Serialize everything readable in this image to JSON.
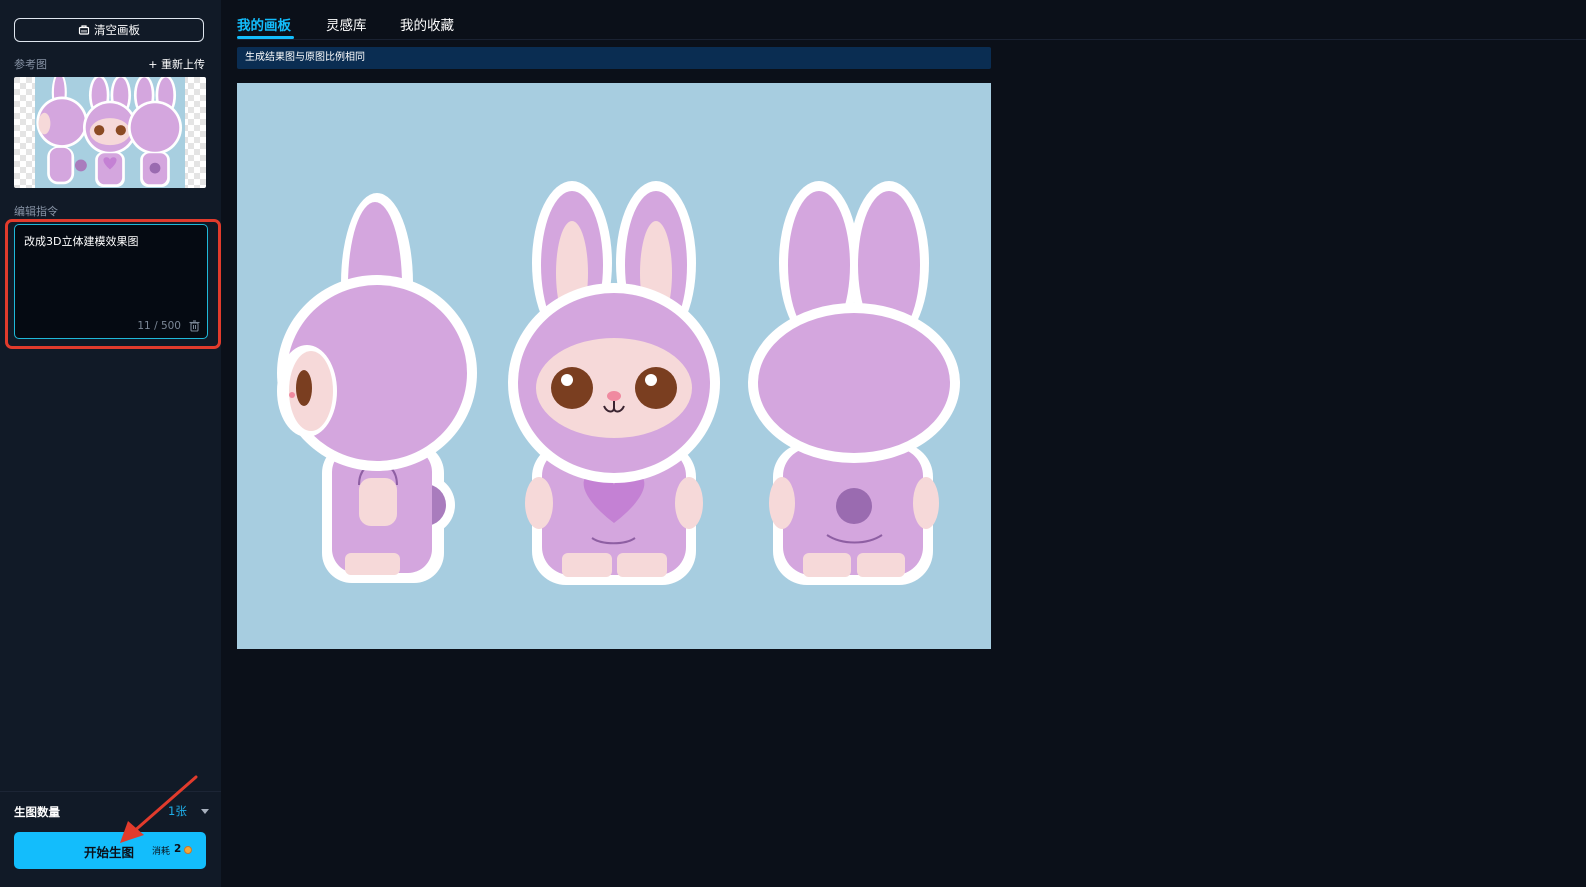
{
  "sidebar": {
    "clear_button": "清空画板",
    "reference_label": "参考图",
    "reupload_label": "+ 重新上传",
    "command_label": "编辑指令",
    "command_text": "改成3D立体建模效果图",
    "char_count": "11 / 500",
    "image_count_label": "生图数量",
    "image_count_value": "1张",
    "generate_label": "开始生图",
    "cost_label": "消耗",
    "cost_value": "2"
  },
  "tabs": [
    "我的画板",
    "灵感库",
    "我的收藏"
  ],
  "notice": "生成结果图与原图比例相同",
  "colors": {
    "accent": "#13bdfc",
    "background": "#0b1019",
    "sidebar": "#111a27",
    "highlight_frame": "#e23b2c",
    "canvas_bg": "#a7cde0",
    "bunny_purple": "#d4a6de"
  }
}
